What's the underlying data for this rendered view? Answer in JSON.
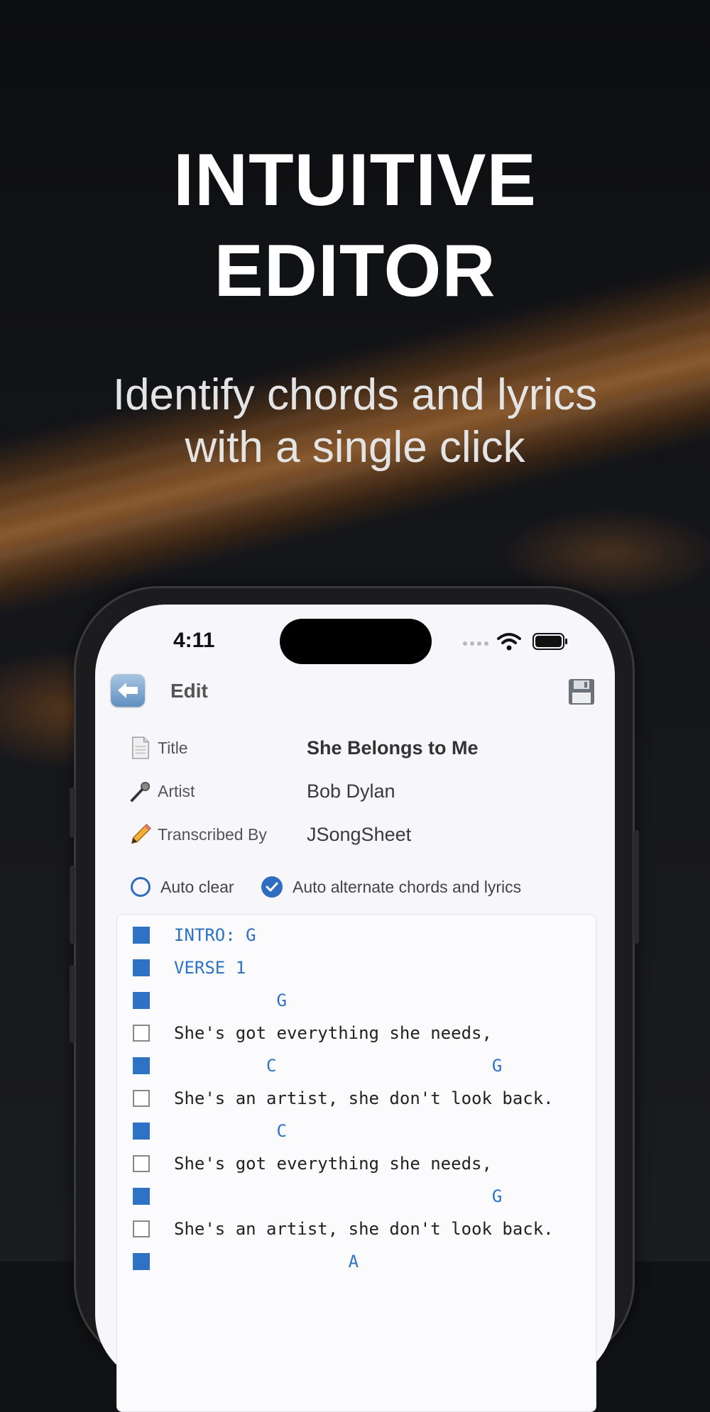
{
  "promo": {
    "headline_line1": "INTUITIVE",
    "headline_line2": "EDITOR",
    "subhead_line1": "Identify chords and lyrics",
    "subhead_line2": "with a single click"
  },
  "status_bar": {
    "time": "4:11"
  },
  "nav": {
    "title": "Edit",
    "back_icon": "back-arrow-icon",
    "save_icon": "floppy-disk-icon"
  },
  "fields": [
    {
      "label": "Title",
      "value": "She Belongs to Me",
      "icon": "page-icon"
    },
    {
      "label": "Artist",
      "value": "Bob Dylan",
      "icon": "microphone-icon"
    },
    {
      "label": "Transcribed By",
      "value": "JSongSheet",
      "icon": "pencil-icon"
    }
  ],
  "options": {
    "auto_clear": {
      "label": "Auto clear",
      "checked": false
    },
    "auto_alternate": {
      "label": "Auto alternate chords and lyrics",
      "checked": true
    }
  },
  "editor_lines": [
    {
      "text": "INTRO: G",
      "is_chord": true
    },
    {
      "text": "VERSE 1",
      "is_chord": true
    },
    {
      "text": "          G",
      "is_chord": true
    },
    {
      "text": "She's got everything she needs,",
      "is_chord": false
    },
    {
      "text": "         C                     G",
      "is_chord": true
    },
    {
      "text": "She's an artist, she don't look back.",
      "is_chord": false
    },
    {
      "text": "          C",
      "is_chord": true
    },
    {
      "text": "She's got everything she needs,",
      "is_chord": false
    },
    {
      "text": "                               G",
      "is_chord": true
    },
    {
      "text": "She's an artist, she don't look back.",
      "is_chord": false
    },
    {
      "text": "                 A",
      "is_chord": true
    }
  ],
  "colors": {
    "accent": "#2e72c5",
    "screen_bg": "#f7f6fb",
    "page_bg": "#111214"
  }
}
